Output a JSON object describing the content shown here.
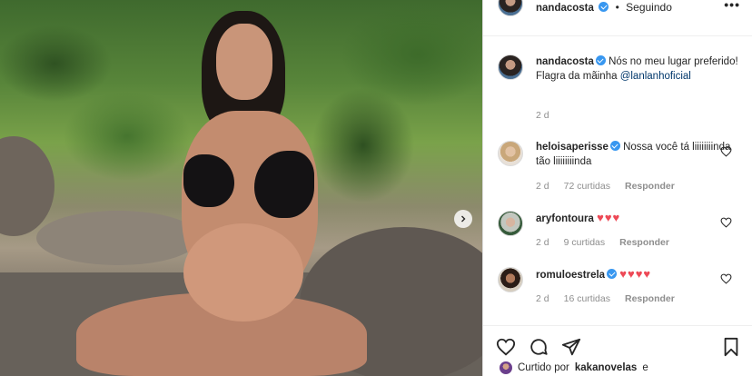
{
  "post": {
    "username": "nandacosta",
    "separator": "•",
    "follow_status": "Seguindo",
    "more_label": "•••"
  },
  "caption": {
    "username": "nandacosta",
    "text": "Nós no meu lugar preferido! Flagra da mãinha",
    "mention": "@lanlanhoficial",
    "timestamp": "2 d"
  },
  "comments": [
    {
      "username": "heloisaperisse",
      "text": "Nossa você tá liiiiiiiinda tão liiiiiiiinda",
      "time": "2 d",
      "likes": "72 curtidas",
      "reply": "Responder"
    },
    {
      "username": "aryfontoura",
      "text": "♥♥♥",
      "time": "2 d",
      "likes": "9 curtidas",
      "reply": "Responder"
    },
    {
      "username": "romuloestrela",
      "text": "♥♥♥♥",
      "time": "2 d",
      "likes": "16 curtidas",
      "reply": "Responder"
    }
  ],
  "footer": {
    "liked_prefix": "Curtido por",
    "liked_user": "kakanovelas",
    "liked_suffix": "e"
  },
  "icons": {
    "verified": "verified-badge-icon",
    "like": "heart-icon",
    "comment": "comment-bubble-icon",
    "share": "paper-plane-icon",
    "save": "bookmark-icon",
    "carousel_next": "chevron-right-icon"
  },
  "colors": {
    "verified": "#3897f0",
    "heart_red": "#ed4956",
    "link": "#00376b",
    "muted": "#8e8e8e"
  }
}
